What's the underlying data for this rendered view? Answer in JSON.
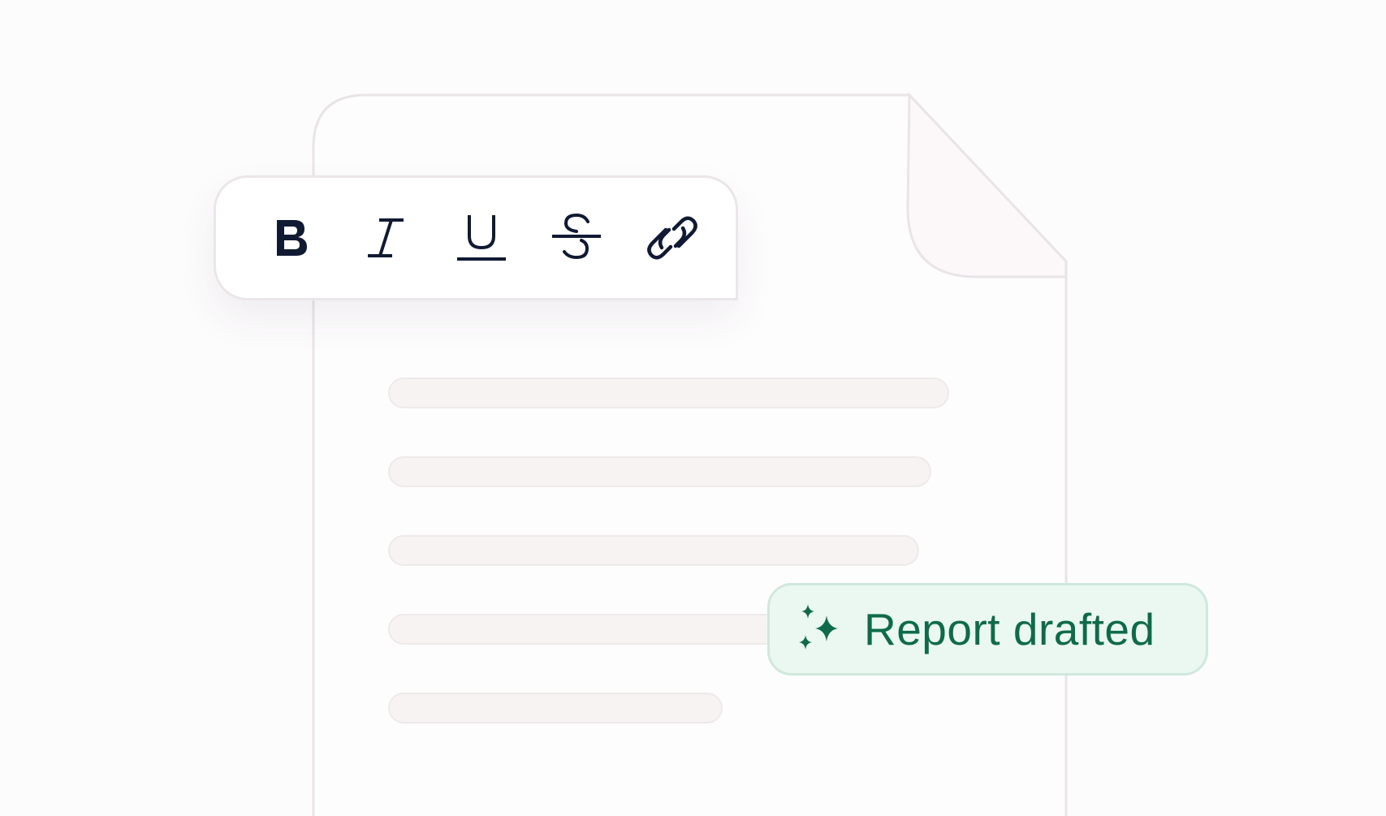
{
  "toolbar": {
    "items": [
      {
        "name": "bold",
        "icon": "bold-icon"
      },
      {
        "name": "italic",
        "icon": "italic-icon"
      },
      {
        "name": "underline",
        "icon": "underline-icon"
      },
      {
        "name": "strikethrough",
        "icon": "strikethrough-icon"
      },
      {
        "name": "link",
        "icon": "link-icon"
      }
    ]
  },
  "badge": {
    "icon": "sparkles-icon",
    "text": "Report drafted"
  },
  "document": {
    "text_line_count": 5
  },
  "colors": {
    "icon": "#111a33",
    "badge_text": "#0f6a4c",
    "badge_bg": "#eaf8f1",
    "outline": "#ebe6ea",
    "placeholder": "#f7f3f3"
  }
}
